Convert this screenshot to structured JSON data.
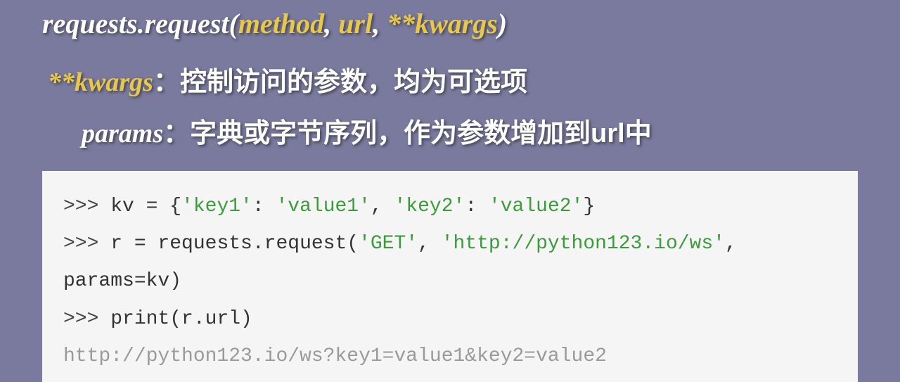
{
  "title": {
    "prefix": "requests.request(",
    "arg1": "method",
    "sep1": ", ",
    "arg2": "url",
    "sep2": ", ",
    "arg3": "**kwargs",
    "suffix": ")"
  },
  "desc1": {
    "label": "**kwargs",
    "colon": "：",
    "text": "控制访问的参数，均为可选项"
  },
  "desc2": {
    "label": "params",
    "colon": "：",
    "text": "字典或字节序列，作为参数增加到url中"
  },
  "code": {
    "l1_prompt": ">>> ",
    "l1_a": "kv = {",
    "l1_s1": "'key1'",
    "l1_b": ": ",
    "l1_s2": "'value1'",
    "l1_c": ", ",
    "l1_s3": "'key2'",
    "l1_d": ": ",
    "l1_s4": "'value2'",
    "l1_e": "}",
    "l2_prompt": ">>> ",
    "l2_a": "r = requests.request(",
    "l2_s1": "'GET'",
    "l2_b": ", ",
    "l2_s2": "'http://python123.io/ws'",
    "l2_c": ", params=kv)",
    "l3_prompt": ">>> ",
    "l3_a": "print(r.url)",
    "l4_out": "http://python123.io/ws?key1=value1&key2=value2"
  }
}
